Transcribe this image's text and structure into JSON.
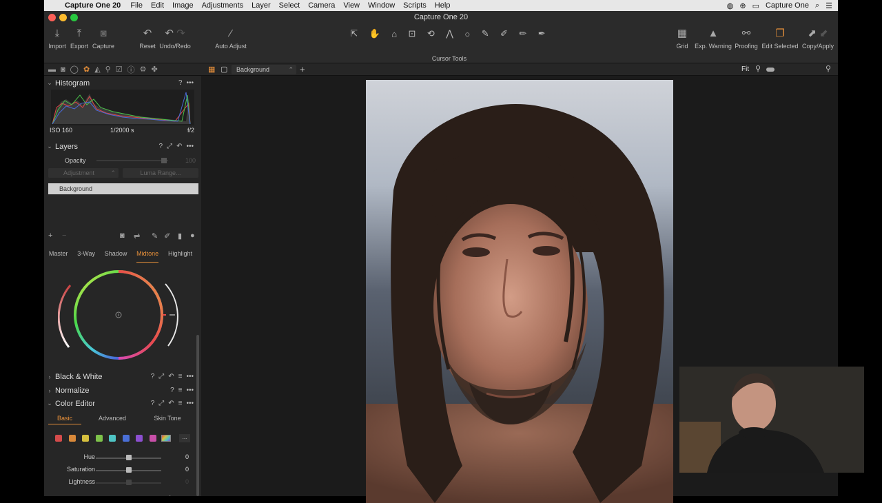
{
  "menubar": {
    "app_name": "Capture One 20",
    "items": [
      "File",
      "Edit",
      "Image",
      "Adjustments",
      "Layer",
      "Select",
      "Camera",
      "View",
      "Window",
      "Scripts",
      "Help"
    ],
    "right_label": "Capture One"
  },
  "window": {
    "title": "Capture One 20"
  },
  "toolbar": {
    "import": "Import",
    "export": "Export",
    "capture": "Capture",
    "reset": "Reset",
    "undo_redo": "Undo/Redo",
    "auto_adjust": "Auto Adjust",
    "cursor_tools": "Cursor Tools",
    "grid": "Grid",
    "exp_warning": "Exp. Warning",
    "proofing": "Proofing",
    "edit_selected": "Edit Selected",
    "copy_apply": "Copy/Apply"
  },
  "histogram": {
    "title": "Histogram",
    "iso": "ISO 160",
    "shutter": "1/2000 s",
    "aperture": "f/2"
  },
  "layers": {
    "title": "Layers",
    "opacity_label": "Opacity",
    "opacity_value": "100",
    "adjustment_dropdown": "Adjustment",
    "luma_range_button": "Luma Range...",
    "layer_name": "Background"
  },
  "color_balance": {
    "tabs": [
      "Master",
      "3-Way",
      "Shadow",
      "Midtone",
      "Highlight"
    ],
    "active_tab": "Midtone"
  },
  "sections": {
    "black_white": "Black & White",
    "normalize": "Normalize",
    "color_editor": "Color Editor"
  },
  "color_editor": {
    "tabs": [
      "Basic",
      "Advanced",
      "Skin Tone"
    ],
    "active_tab": "Basic",
    "swatches": [
      "#d44b4b",
      "#d9893a",
      "#d5bf3e",
      "#7ec24a",
      "#4fc4c4",
      "#4a6fd6",
      "#8c4fd0",
      "#c84fa8"
    ],
    "more_label": "...",
    "sliders": [
      {
        "label": "Hue",
        "value": "0",
        "position": 0.5
      },
      {
        "label": "Saturation",
        "value": "0",
        "position": 0.5
      },
      {
        "label": "Lightness",
        "value": "0",
        "position": 0.5
      }
    ]
  },
  "viewer": {
    "variant_dropdown": "Background",
    "zoom": "Fit"
  },
  "colors": {
    "accent": "#e8903a",
    "panel": "#262626",
    "viewer_bg": "#1b1b1b",
    "toolbar": "#2b2b2b"
  }
}
